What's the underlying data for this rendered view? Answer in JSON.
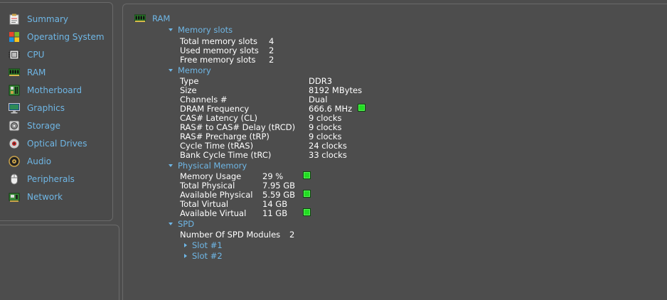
{
  "sidebar": {
    "items": [
      {
        "label": "Summary",
        "icon": "summary-icon"
      },
      {
        "label": "Operating System",
        "icon": "windows-logo-icon"
      },
      {
        "label": "CPU",
        "icon": "cpu-chip-icon"
      },
      {
        "label": "RAM",
        "icon": "ram-stick-icon"
      },
      {
        "label": "Motherboard",
        "icon": "motherboard-icon"
      },
      {
        "label": "Graphics",
        "icon": "monitor-icon"
      },
      {
        "label": "Storage",
        "icon": "hard-drive-icon"
      },
      {
        "label": "Optical Drives",
        "icon": "optical-disc-icon"
      },
      {
        "label": "Audio",
        "icon": "speaker-icon"
      },
      {
        "label": "Peripherals",
        "icon": "mouse-icon"
      },
      {
        "label": "Network",
        "icon": "network-icon"
      }
    ]
  },
  "main": {
    "title": "RAM",
    "memory_slots": {
      "heading": "Memory slots",
      "rows": [
        {
          "label": "Total memory slots",
          "value": "4"
        },
        {
          "label": "Used memory slots",
          "value": "2"
        },
        {
          "label": "Free memory slots",
          "value": "2"
        }
      ]
    },
    "memory": {
      "heading": "Memory",
      "rows": [
        {
          "label": "Type",
          "value": "DDR3"
        },
        {
          "label": "Size",
          "value": "8192 MBytes"
        },
        {
          "label": "Channels #",
          "value": "Dual"
        },
        {
          "label": "DRAM Frequency",
          "value": "666.6 MHz"
        },
        {
          "label": "CAS# Latency (CL)",
          "value": "9 clocks"
        },
        {
          "label": "RAS# to CAS# Delay (tRCD)",
          "value": "9 clocks"
        },
        {
          "label": "RAS# Precharge (tRP)",
          "value": "9 clocks"
        },
        {
          "label": "Cycle Time (tRAS)",
          "value": "24 clocks"
        },
        {
          "label": "Bank Cycle Time (tRC)",
          "value": "33 clocks"
        }
      ]
    },
    "physical_memory": {
      "heading": "Physical Memory",
      "rows": [
        {
          "label": "Memory Usage",
          "value": "29 %"
        },
        {
          "label": "Total Physical",
          "value": "7.95 GB"
        },
        {
          "label": "Available Physical",
          "value": "5.59 GB"
        },
        {
          "label": "Total Virtual",
          "value": "14 GB"
        },
        {
          "label": "Available Virtual",
          "value": "11 GB"
        }
      ]
    },
    "spd": {
      "heading": "SPD",
      "modules_label": "Number Of SPD Modules",
      "modules_value": "2",
      "slots": [
        "Slot #1",
        "Slot #2"
      ]
    }
  },
  "colors": {
    "link_blue": "#6fb7e6",
    "indicator_green": "#22dd22",
    "background": "#4d4d4d"
  }
}
